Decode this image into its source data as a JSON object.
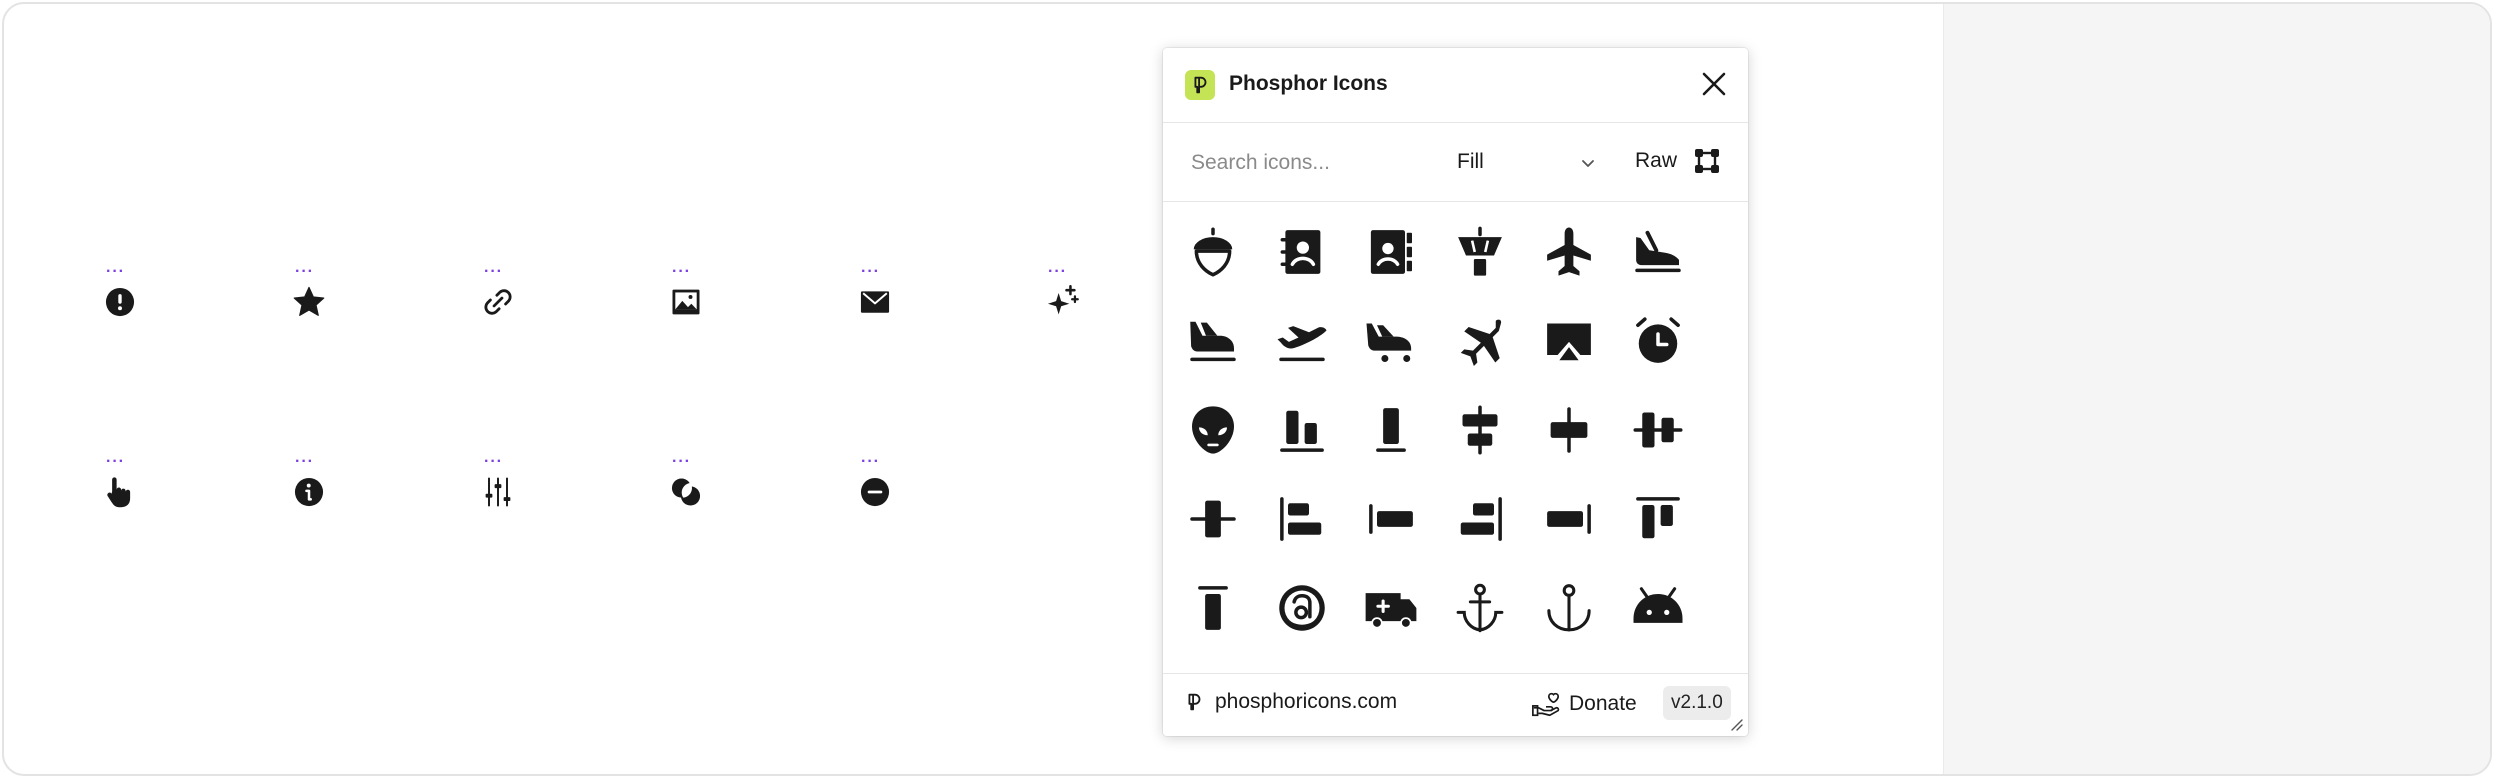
{
  "canvas": {
    "icons": [
      {
        "name": "warning-circle-icon",
        "selected": true
      },
      {
        "name": "star-icon",
        "selected": true
      },
      {
        "name": "link-icon",
        "selected": true
      },
      {
        "name": "image-icon",
        "selected": true
      },
      {
        "name": "envelope-icon",
        "selected": true
      },
      {
        "name": "sparkle-icon",
        "selected": true
      },
      {
        "name": "hand-pointing-icon",
        "selected": true
      },
      {
        "name": "info-icon",
        "selected": true
      },
      {
        "name": "sliders-icon",
        "selected": true
      },
      {
        "name": "intersect-icon",
        "selected": true
      },
      {
        "name": "minus-circle-icon",
        "selected": true
      }
    ],
    "selection_dots": "···"
  },
  "plugin": {
    "title": "Phosphor Icons",
    "search_placeholder": "Search icons...",
    "weight_select": {
      "selected": "Fill"
    },
    "raw_label": "Raw",
    "grid_icons": [
      "acorn-icon",
      "address-book-icon",
      "address-book-tabs-icon",
      "airport-tower-icon",
      "airplane-icon",
      "airplane-landing-icon",
      "airplane-in-flight-icon",
      "airplane-takeoff-icon",
      "airplane-taxiing-icon",
      "airplane-tilt-icon",
      "airplay-icon",
      "alarm-icon",
      "alien-icon",
      "align-bottom-icon",
      "align-bottom-simple-icon",
      "align-center-horizontal-icon",
      "align-center-horizontal-simple-icon",
      "align-center-vertical-icon",
      "align-center-vertical-simple-icon",
      "align-left-icon",
      "align-left-simple-icon",
      "align-right-icon",
      "align-right-simple-icon",
      "align-top-icon",
      "align-top-simple-icon",
      "amazon-logo-icon",
      "ambulance-icon",
      "anchor-icon",
      "anchor-simple-icon",
      "android-logo-icon"
    ],
    "footer": {
      "site": "phosphoricons.com",
      "donate": "Donate",
      "version": "v2.1.0"
    },
    "colors": {
      "logo_bg": "#c4e456",
      "selection": "#7b3fe4"
    }
  }
}
